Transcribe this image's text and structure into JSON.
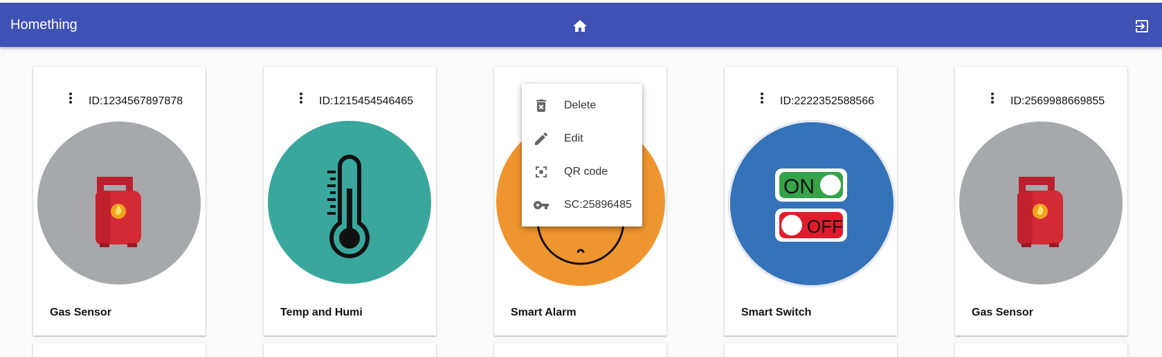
{
  "app": {
    "title": "Homething"
  },
  "colors": {
    "appbar": "#3f51b5",
    "gas": "#a7a8ac",
    "temp": "#39a79c",
    "alarm": "#ef9530",
    "switch": "#3472ba"
  },
  "icons": {
    "home": "home-icon",
    "logout": "exit-to-app-icon",
    "card_menu": "more-vert-icon"
  },
  "cards": [
    {
      "id": "ID:1234567897878",
      "name": "Gas Sensor"
    },
    {
      "id": "ID:1215454546465",
      "name": "Temp and Humi"
    },
    {
      "id": "",
      "name": "Smart Alarm"
    },
    {
      "id": "ID:2222352588566",
      "name": "Smart Switch"
    },
    {
      "id": "ID:2569988669855",
      "name": "Gas Sensor"
    }
  ],
  "switch_labels": {
    "on": "ON",
    "off": "OFF"
  },
  "context_menu": {
    "items": [
      {
        "label": "Delete",
        "icon": "delete-icon"
      },
      {
        "label": "Edit",
        "icon": "edit-icon"
      },
      {
        "label": "QR code",
        "icon": "qr-scan-icon"
      },
      {
        "label": "SC:25896485",
        "icon": "key-icon"
      }
    ]
  }
}
